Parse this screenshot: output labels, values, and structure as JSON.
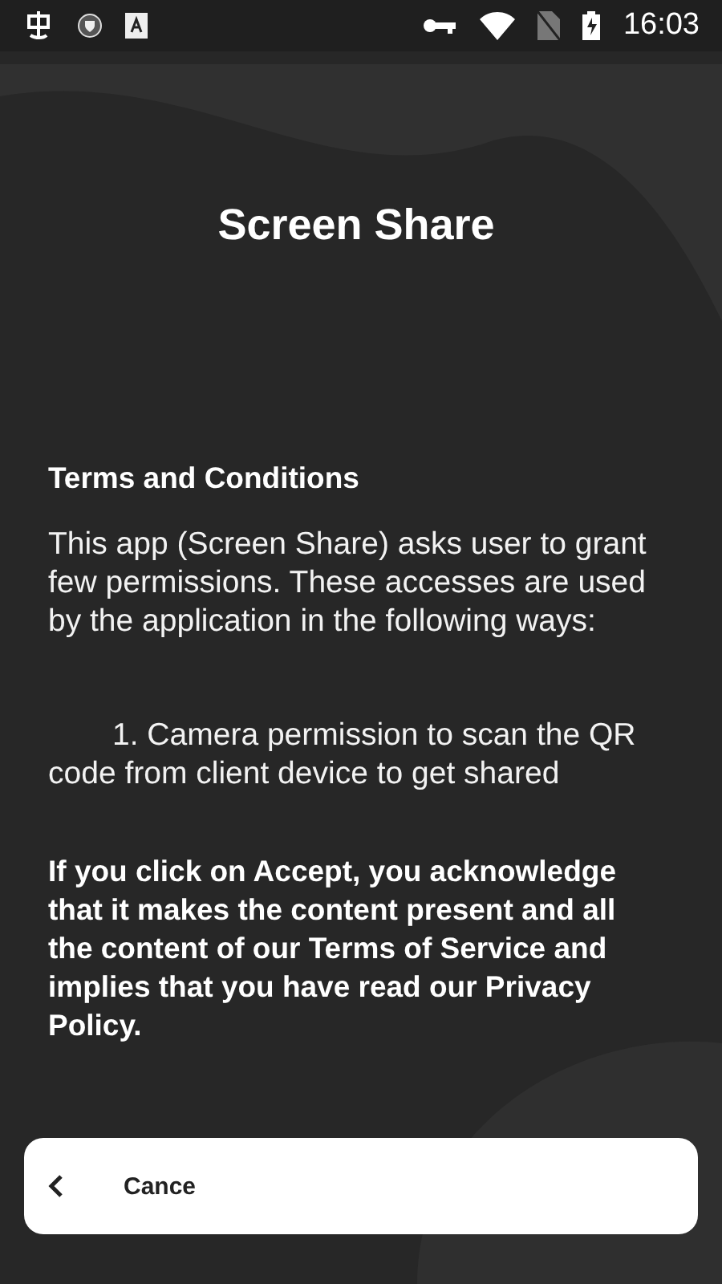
{
  "status_bar": {
    "time": "16:03"
  },
  "title": "Screen Share",
  "terms": {
    "heading": "Terms and Conditions",
    "intro": "This app (Screen Share) asks user to grant few permissions. These accesses are used by the application in the following ways:",
    "items": [
      "1. Camera permission to scan the QR code from client device to get shared"
    ],
    "notice": "If you click on Accept, you acknowledge that it makes the content present and all the content of our Terms of Service and implies that you have read our Privacy Policy."
  },
  "bottom_bar": {
    "cancel_label": "Cance"
  }
}
